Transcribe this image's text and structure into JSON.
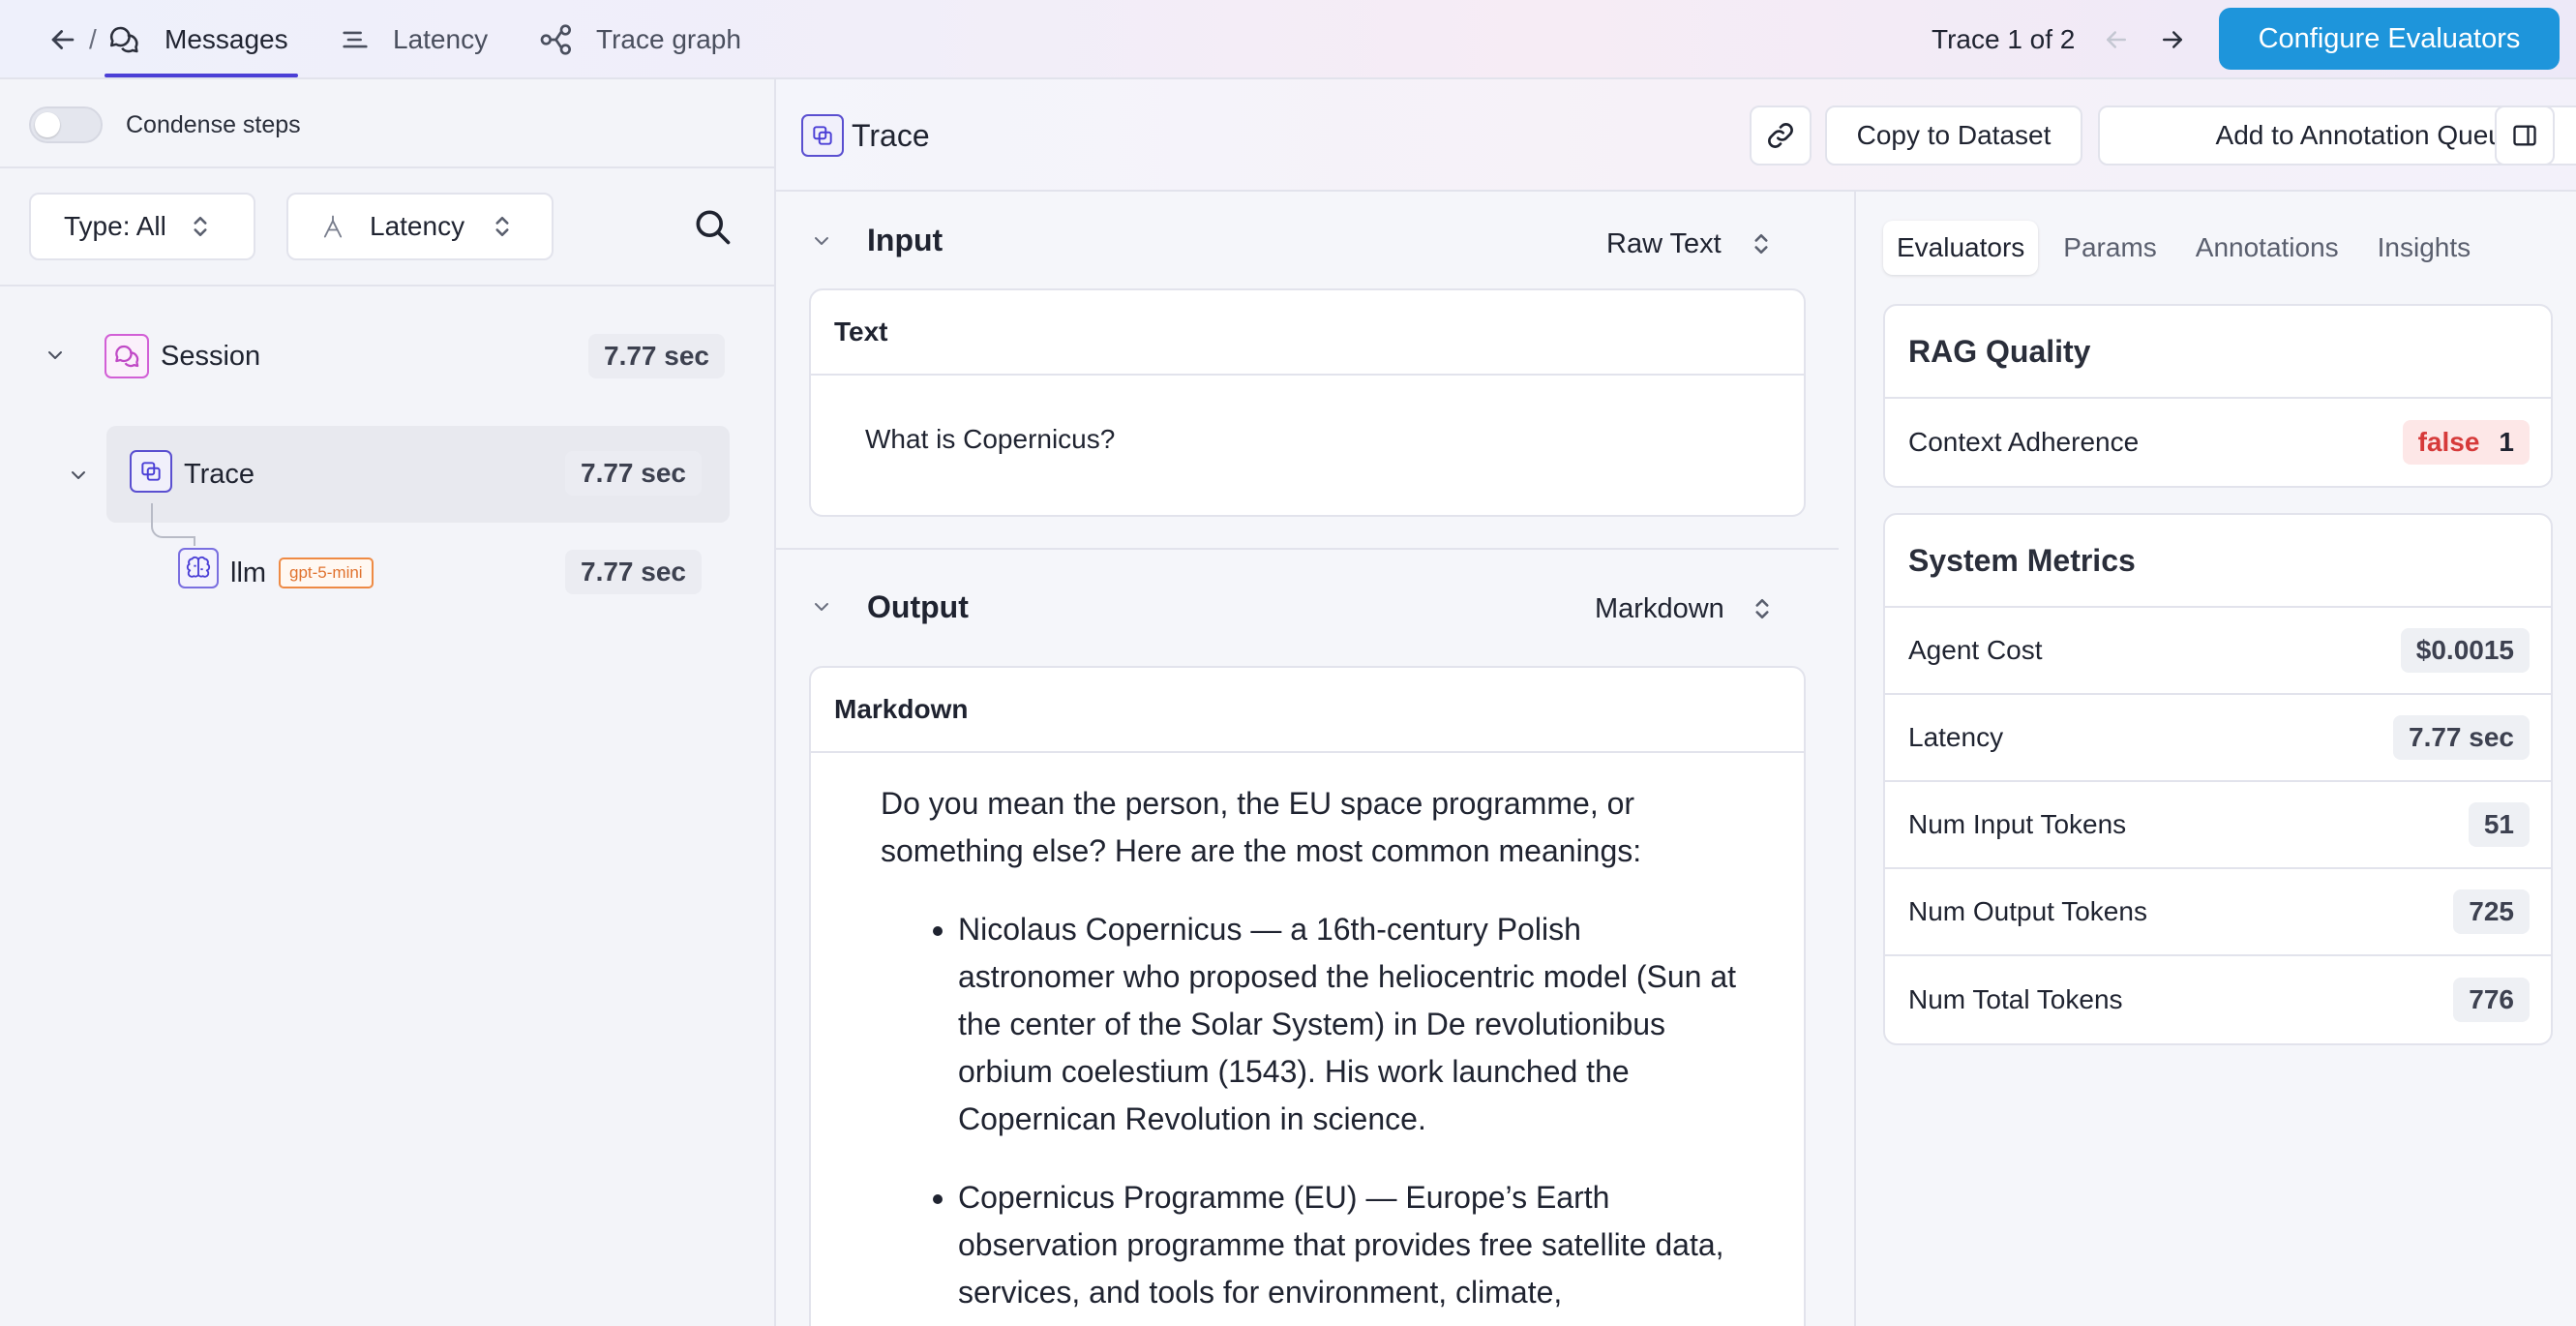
{
  "topbar": {
    "separator": "/",
    "tabs": [
      {
        "label": "Messages",
        "icon": "messages-icon"
      },
      {
        "label": "Latency",
        "icon": "latency-icon"
      },
      {
        "label": "Trace graph",
        "icon": "trace-graph-icon"
      }
    ],
    "trace_nav": "Trace 1 of 2",
    "configure_button": "Configure Evaluators"
  },
  "left": {
    "condense_label": "Condense steps",
    "type_filter": "Type: All",
    "sort_filter": "Latency",
    "tree": {
      "session": {
        "label": "Session",
        "duration": "7.77 sec"
      },
      "trace": {
        "label": "Trace",
        "duration": "7.77 sec"
      },
      "llm": {
        "label": "llm",
        "model_tag": "gpt-5-mini",
        "duration": "7.77 sec"
      }
    }
  },
  "header": {
    "title": "Trace",
    "copy_dataset": "Copy to Dataset",
    "annotation_queue": "Add to Annotation Queue"
  },
  "input": {
    "title": "Input",
    "format": "Raw Text",
    "card_label": "Text",
    "text": "What is Copernicus?"
  },
  "output": {
    "title": "Output",
    "format": "Markdown",
    "card_label": "Markdown",
    "intro": "Do you mean the person, the EU space programme, or something else? Here are the most common meanings:",
    "bullets": [
      "Nicolaus Copernicus — a 16th-century Polish astronomer who proposed the heliocentric model (Sun at the center of the Solar System) in De revolutionibus orbium coelestium (1543). His work launched the Copernican Revolution in science.",
      "Copernicus Programme (EU) — Europe’s Earth observation programme that provides free satellite data, services, and tools for environment, climate,"
    ]
  },
  "right": {
    "tabs": [
      "Evaluators",
      "Params",
      "Annotations",
      "Insights"
    ],
    "rag": {
      "title": "RAG Quality",
      "metric_label": "Context Adherence",
      "value": "false",
      "count": "1"
    },
    "system": {
      "title": "System Metrics",
      "rows": [
        {
          "label": "Agent Cost",
          "value": "$0.0015"
        },
        {
          "label": "Latency",
          "value": "7.77 sec"
        },
        {
          "label": "Num Input Tokens",
          "value": "51"
        },
        {
          "label": "Num Output Tokens",
          "value": "725"
        },
        {
          "label": "Num Total Tokens",
          "value": "776"
        }
      ]
    }
  },
  "colors": {
    "accent": "#4b3fd6",
    "primary_button": "#1e95db",
    "false_text": "#d63a3a",
    "model_tag": "#e0722e"
  }
}
